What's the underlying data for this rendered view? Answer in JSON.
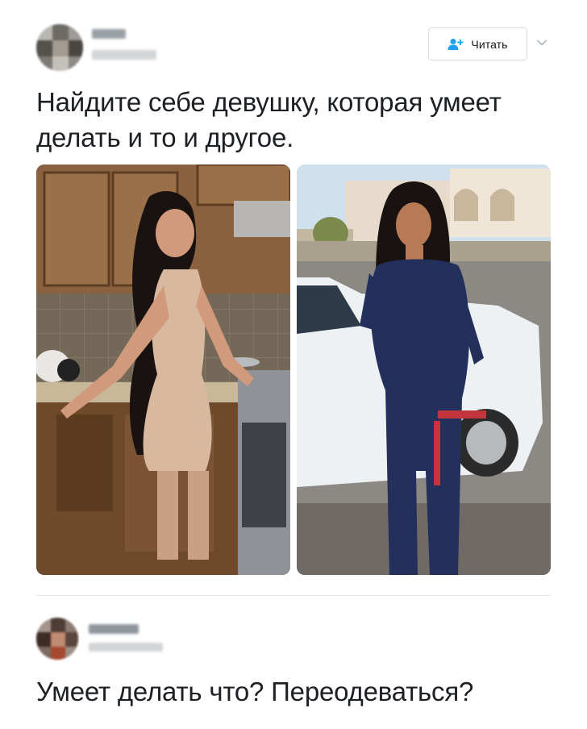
{
  "tweet": {
    "text": "Найдите себе девушку, которая умеет делать и то и другое.",
    "follow_label": "Читать",
    "icons": {
      "follow": "add-user-icon",
      "caret": "chevron-down-icon"
    },
    "accent_color": "#1da1f2"
  },
  "reply": {
    "text": "Умеет делать что? Переодеваться?"
  }
}
